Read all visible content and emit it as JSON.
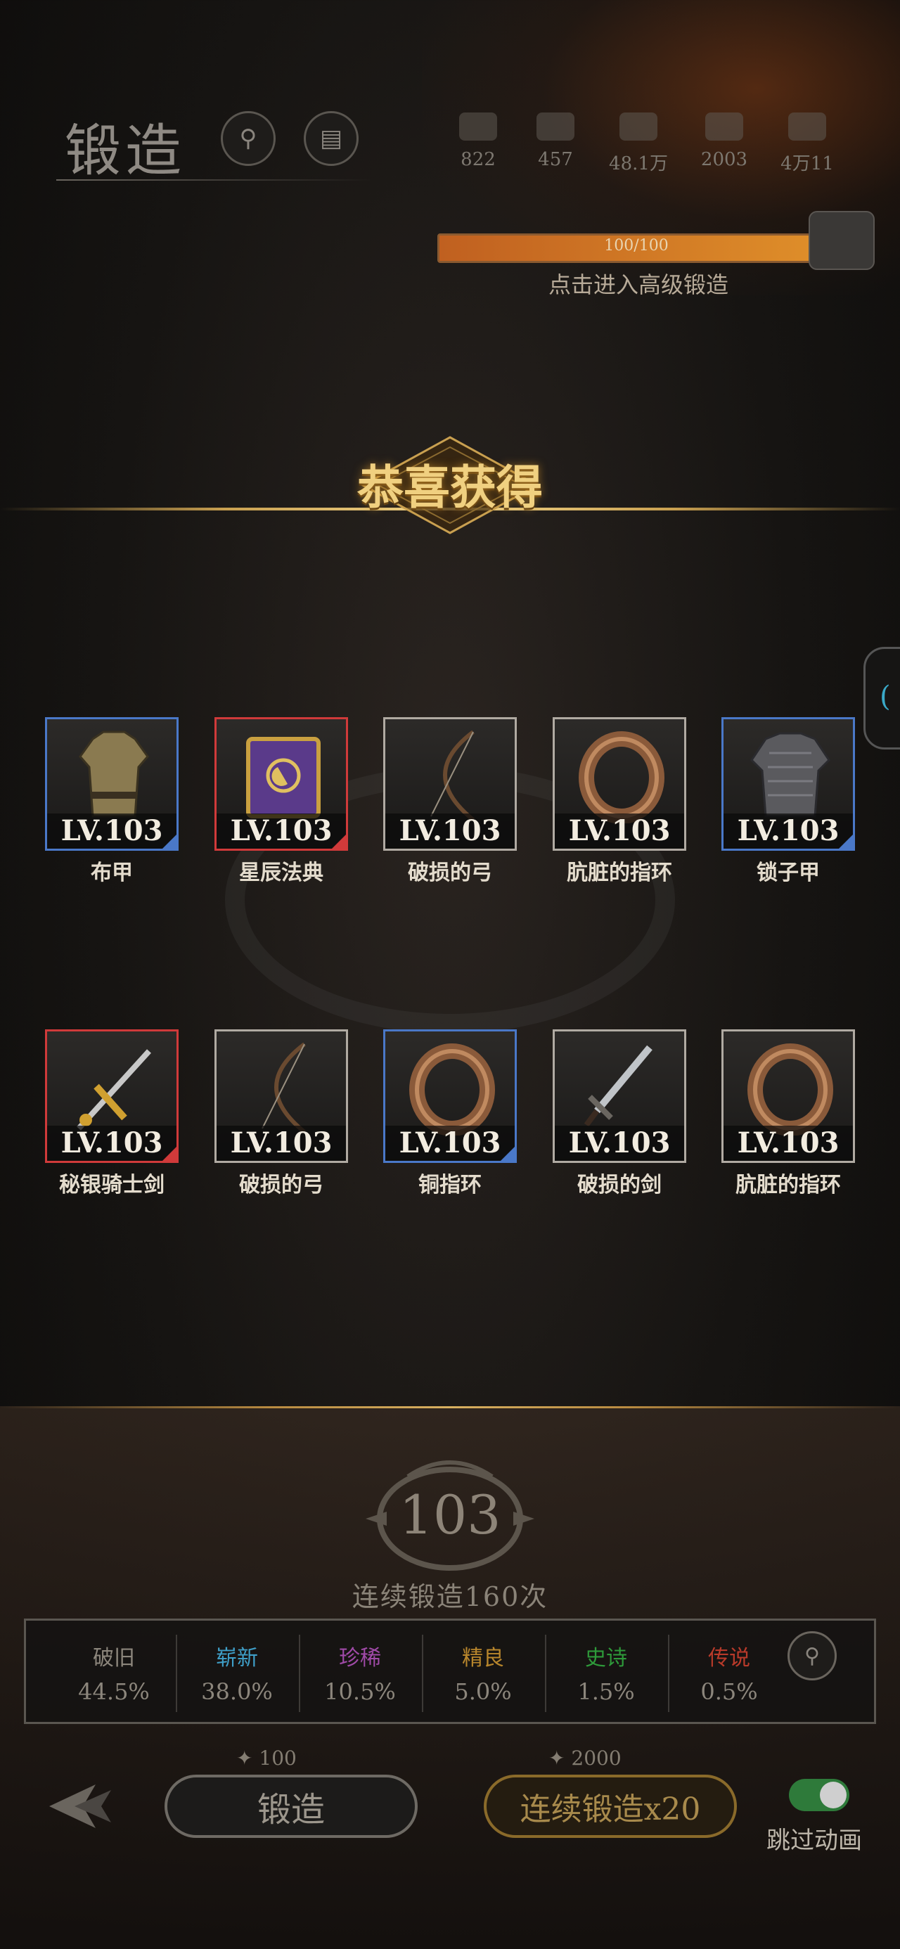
{
  "header": {
    "title": "锻造",
    "search_icon": "search-icon",
    "list_icon": "scroll-icon"
  },
  "resources": [
    {
      "icon": "gem-icon",
      "value": "822"
    },
    {
      "icon": "ingot-icon",
      "value": "457"
    },
    {
      "icon": "ore-icon",
      "value": "48.1万"
    },
    {
      "icon": "crystal-icon",
      "value": "2003"
    },
    {
      "icon": "coin-icon",
      "value": "4万11"
    }
  ],
  "forge_progress": {
    "bar_text": "100/100",
    "fraction": 1.0,
    "subtitle": "点击进入高级锻造"
  },
  "banner": {
    "title": "恭喜获得"
  },
  "items": [
    {
      "level": "LV.103",
      "name": "布甲",
      "rarity": "blue",
      "art": "cloth-armor-icon"
    },
    {
      "level": "LV.103",
      "name": "星辰法典",
      "rarity": "red",
      "art": "spellbook-icon"
    },
    {
      "level": "LV.103",
      "name": "破损的弓",
      "rarity": "white",
      "art": "bow-icon"
    },
    {
      "level": "LV.103",
      "name": "肮脏的指环",
      "rarity": "white",
      "art": "ring-icon"
    },
    {
      "level": "LV.103",
      "name": "锁子甲",
      "rarity": "blue",
      "art": "chainmail-icon"
    },
    {
      "level": "LV.103",
      "name": "秘银骑士剑",
      "rarity": "red",
      "art": "ornate-sword-icon"
    },
    {
      "level": "LV.103",
      "name": "破损的弓",
      "rarity": "white",
      "art": "bow-icon"
    },
    {
      "level": "LV.103",
      "name": "铜指环",
      "rarity": "blue",
      "art": "ring-icon"
    },
    {
      "level": "LV.103",
      "name": "破损的剑",
      "rarity": "white",
      "art": "sword-icon"
    },
    {
      "level": "LV.103",
      "name": "肮脏的指环",
      "rarity": "white",
      "art": "ring-icon"
    }
  ],
  "bottom": {
    "forge_level": "103",
    "series_text": "连续锻造160次",
    "probabilities": [
      {
        "quality": "破旧",
        "percent": "44.5%",
        "color": "#8c867c"
      },
      {
        "quality": "崭新",
        "percent": "38.0%",
        "color": "#3f9fc8"
      },
      {
        "quality": "珍稀",
        "percent": "10.5%",
        "color": "#a04aa8"
      },
      {
        "quality": "精良",
        "percent": "5.0%",
        "color": "#b8862c"
      },
      {
        "quality": "史诗",
        "percent": "1.5%",
        "color": "#2e9a3a"
      },
      {
        "quality": "传说",
        "percent": "0.5%",
        "color": "#b83a2a"
      }
    ],
    "forge_cost": "100",
    "multi_cost": "2000",
    "forge_button": "锻造",
    "multi_button": "连续锻造x20",
    "skip_label": "跳过动画",
    "skip_on": true
  }
}
